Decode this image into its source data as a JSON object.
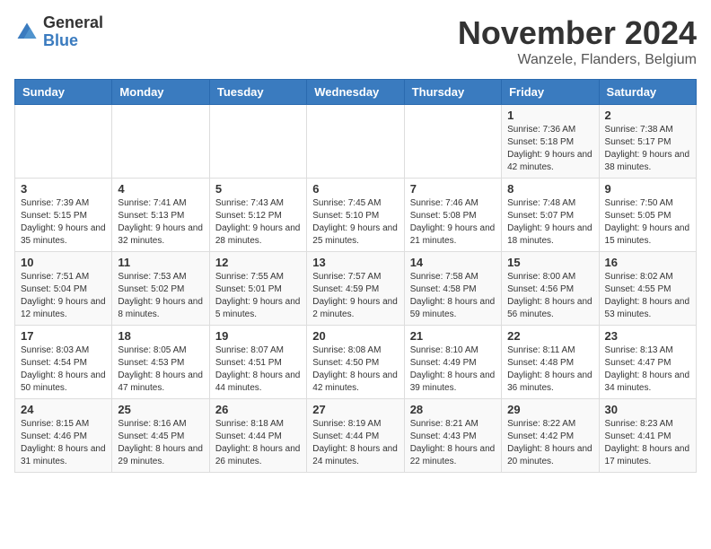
{
  "header": {
    "logo_general": "General",
    "logo_blue": "Blue",
    "month_title": "November 2024",
    "location": "Wanzele, Flanders, Belgium"
  },
  "weekdays": [
    "Sunday",
    "Monday",
    "Tuesday",
    "Wednesday",
    "Thursday",
    "Friday",
    "Saturday"
  ],
  "weeks": [
    [
      {
        "day": "",
        "info": ""
      },
      {
        "day": "",
        "info": ""
      },
      {
        "day": "",
        "info": ""
      },
      {
        "day": "",
        "info": ""
      },
      {
        "day": "",
        "info": ""
      },
      {
        "day": "1",
        "info": "Sunrise: 7:36 AM\nSunset: 5:18 PM\nDaylight: 9 hours and 42 minutes."
      },
      {
        "day": "2",
        "info": "Sunrise: 7:38 AM\nSunset: 5:17 PM\nDaylight: 9 hours and 38 minutes."
      }
    ],
    [
      {
        "day": "3",
        "info": "Sunrise: 7:39 AM\nSunset: 5:15 PM\nDaylight: 9 hours and 35 minutes."
      },
      {
        "day": "4",
        "info": "Sunrise: 7:41 AM\nSunset: 5:13 PM\nDaylight: 9 hours and 32 minutes."
      },
      {
        "day": "5",
        "info": "Sunrise: 7:43 AM\nSunset: 5:12 PM\nDaylight: 9 hours and 28 minutes."
      },
      {
        "day": "6",
        "info": "Sunrise: 7:45 AM\nSunset: 5:10 PM\nDaylight: 9 hours and 25 minutes."
      },
      {
        "day": "7",
        "info": "Sunrise: 7:46 AM\nSunset: 5:08 PM\nDaylight: 9 hours and 21 minutes."
      },
      {
        "day": "8",
        "info": "Sunrise: 7:48 AM\nSunset: 5:07 PM\nDaylight: 9 hours and 18 minutes."
      },
      {
        "day": "9",
        "info": "Sunrise: 7:50 AM\nSunset: 5:05 PM\nDaylight: 9 hours and 15 minutes."
      }
    ],
    [
      {
        "day": "10",
        "info": "Sunrise: 7:51 AM\nSunset: 5:04 PM\nDaylight: 9 hours and 12 minutes."
      },
      {
        "day": "11",
        "info": "Sunrise: 7:53 AM\nSunset: 5:02 PM\nDaylight: 9 hours and 8 minutes."
      },
      {
        "day": "12",
        "info": "Sunrise: 7:55 AM\nSunset: 5:01 PM\nDaylight: 9 hours and 5 minutes."
      },
      {
        "day": "13",
        "info": "Sunrise: 7:57 AM\nSunset: 4:59 PM\nDaylight: 9 hours and 2 minutes."
      },
      {
        "day": "14",
        "info": "Sunrise: 7:58 AM\nSunset: 4:58 PM\nDaylight: 8 hours and 59 minutes."
      },
      {
        "day": "15",
        "info": "Sunrise: 8:00 AM\nSunset: 4:56 PM\nDaylight: 8 hours and 56 minutes."
      },
      {
        "day": "16",
        "info": "Sunrise: 8:02 AM\nSunset: 4:55 PM\nDaylight: 8 hours and 53 minutes."
      }
    ],
    [
      {
        "day": "17",
        "info": "Sunrise: 8:03 AM\nSunset: 4:54 PM\nDaylight: 8 hours and 50 minutes."
      },
      {
        "day": "18",
        "info": "Sunrise: 8:05 AM\nSunset: 4:53 PM\nDaylight: 8 hours and 47 minutes."
      },
      {
        "day": "19",
        "info": "Sunrise: 8:07 AM\nSunset: 4:51 PM\nDaylight: 8 hours and 44 minutes."
      },
      {
        "day": "20",
        "info": "Sunrise: 8:08 AM\nSunset: 4:50 PM\nDaylight: 8 hours and 42 minutes."
      },
      {
        "day": "21",
        "info": "Sunrise: 8:10 AM\nSunset: 4:49 PM\nDaylight: 8 hours and 39 minutes."
      },
      {
        "day": "22",
        "info": "Sunrise: 8:11 AM\nSunset: 4:48 PM\nDaylight: 8 hours and 36 minutes."
      },
      {
        "day": "23",
        "info": "Sunrise: 8:13 AM\nSunset: 4:47 PM\nDaylight: 8 hours and 34 minutes."
      }
    ],
    [
      {
        "day": "24",
        "info": "Sunrise: 8:15 AM\nSunset: 4:46 PM\nDaylight: 8 hours and 31 minutes."
      },
      {
        "day": "25",
        "info": "Sunrise: 8:16 AM\nSunset: 4:45 PM\nDaylight: 8 hours and 29 minutes."
      },
      {
        "day": "26",
        "info": "Sunrise: 8:18 AM\nSunset: 4:44 PM\nDaylight: 8 hours and 26 minutes."
      },
      {
        "day": "27",
        "info": "Sunrise: 8:19 AM\nSunset: 4:44 PM\nDaylight: 8 hours and 24 minutes."
      },
      {
        "day": "28",
        "info": "Sunrise: 8:21 AM\nSunset: 4:43 PM\nDaylight: 8 hours and 22 minutes."
      },
      {
        "day": "29",
        "info": "Sunrise: 8:22 AM\nSunset: 4:42 PM\nDaylight: 8 hours and 20 minutes."
      },
      {
        "day": "30",
        "info": "Sunrise: 8:23 AM\nSunset: 4:41 PM\nDaylight: 8 hours and 17 minutes."
      }
    ]
  ]
}
